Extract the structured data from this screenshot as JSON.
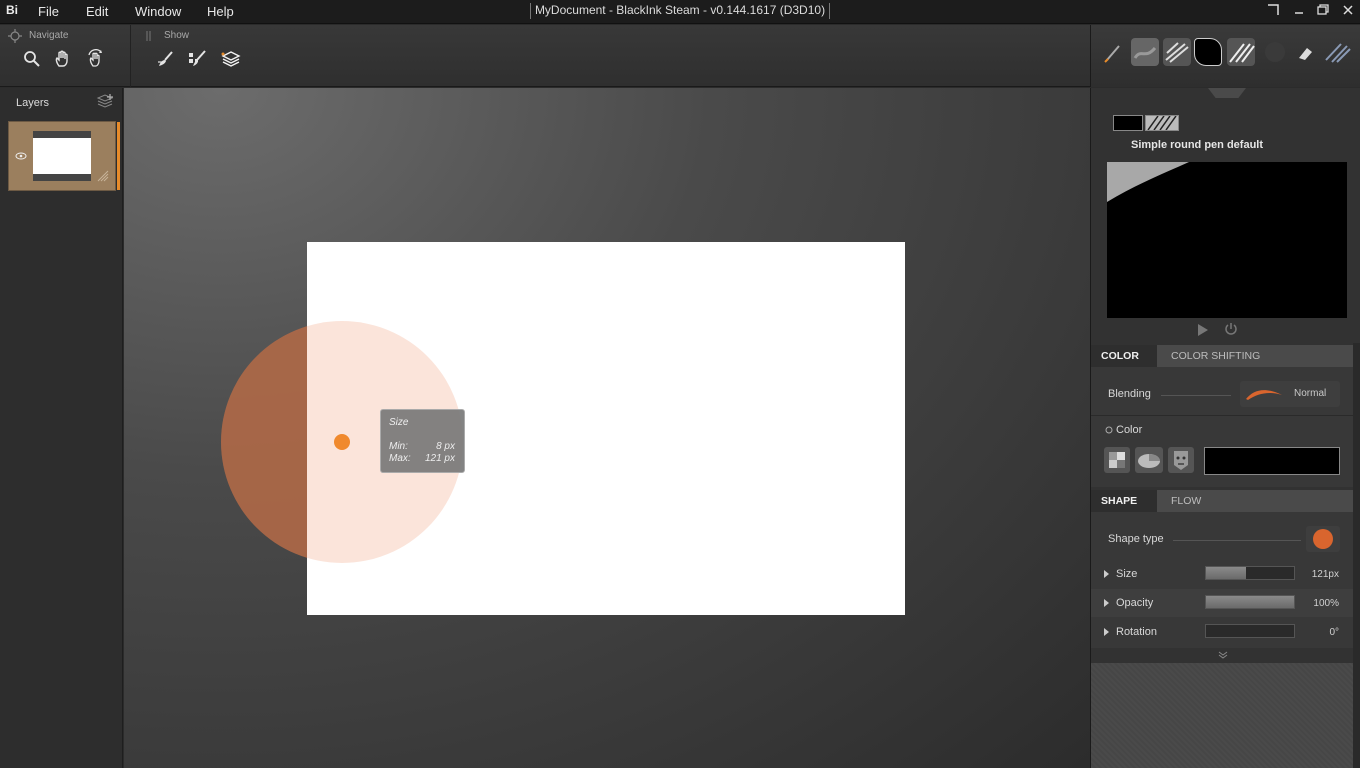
{
  "app": {
    "logo": "Bi",
    "window_title": "MyDocument - BlackInk Steam - v0.144.1617 (D3D10)"
  },
  "menu": [
    "File",
    "Edit",
    "Window",
    "Help"
  ],
  "toolbar": {
    "navigate_label": "Navigate",
    "show_label": "Show"
  },
  "layers": {
    "title": "Layers"
  },
  "tooltip": {
    "title": "Size",
    "min_label": "Min:",
    "min_value": "8 px",
    "max_label": "Max:",
    "max_value": "121 px"
  },
  "brush": {
    "preset_name": "Simple round pen default"
  },
  "color_tabs": [
    "COLOR",
    "COLOR SHIFTING"
  ],
  "color_section": {
    "blending_label": "Blending",
    "blending_value": "Normal",
    "color_label": "Color",
    "color_value": "#000000"
  },
  "shape_tabs": [
    "SHAPE",
    "FLOW"
  ],
  "shape_section": {
    "shape_type_label": "Shape type",
    "shape_color": "#d9652e",
    "params": [
      {
        "label": "Size",
        "value": "121px",
        "level": 0.45
      },
      {
        "label": "Opacity",
        "value": "100%",
        "level": 1.0
      },
      {
        "label": "Rotation",
        "value": "0°",
        "level": 0.0
      }
    ]
  },
  "colors": {
    "accent": "#e78b2a",
    "brush_cursor": "#f0892d"
  }
}
